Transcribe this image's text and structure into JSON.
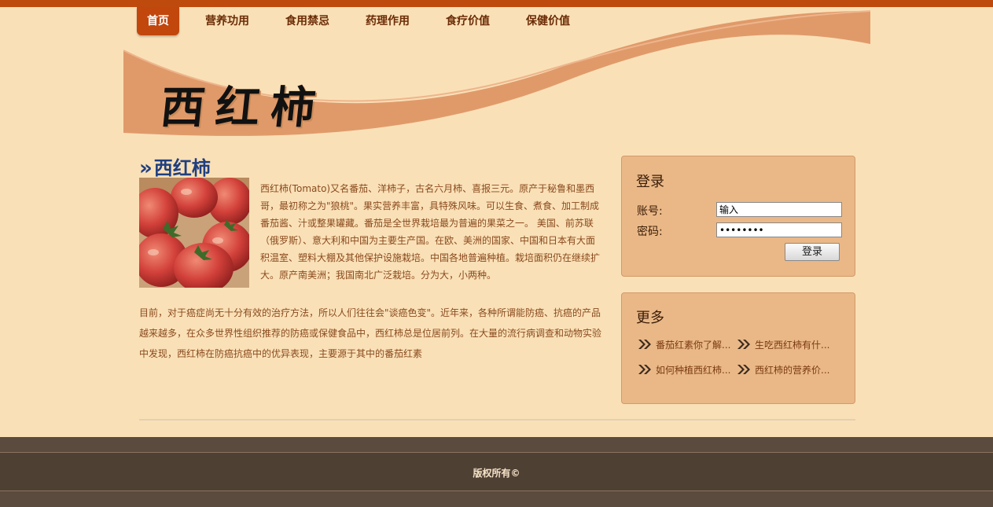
{
  "colors": {
    "top_bar": "#bf4a0e",
    "page_background": "#fae0b7",
    "banner_swoosh": "#e09a6a",
    "nav_active": "#c2470d",
    "title_blue": "#1f3f80",
    "sidebar_box": "#eab887",
    "footer": "#4f4034"
  },
  "nav": {
    "items": [
      {
        "label": "首页",
        "active": true
      },
      {
        "label": "营养功用"
      },
      {
        "label": "食用禁忌"
      },
      {
        "label": "药理作用"
      },
      {
        "label": "食疗价值"
      },
      {
        "label": "保健价值"
      }
    ]
  },
  "banner": {
    "logo_text": "西红柿"
  },
  "article": {
    "title_marker": "»",
    "title": "西红柿",
    "image_icon": "tomato-photo",
    "paragraph1": "西红柿(Tomato)又名番茄、洋柿子，古名六月柿、喜报三元。原产于秘鲁和墨西哥，最初称之为\"狼桃\"。果实营养丰富，具特殊风味。可以生食、煮食、加工制成番茄酱、汁或整果罐藏。番茄是全世界栽培最为普遍的果菜之一。 美国、前苏联（俄罗斯）、意大利和中国为主要生产国。在欧、美洲的国家、中国和日本有大面积温室、塑料大棚及其他保护设施栽培。中国各地普遍种植。栽培面积仍在继续扩大。原产南美洲；我国南北广泛栽培。分为大，小两种。",
    "paragraph2": "目前，对于癌症尚无十分有效的治疗方法，所以人们往往会\"谈癌色变\"。近年来，各种所谓能防癌、抗癌的产品越来越多，在众多世界性组织推荐的防癌或保健食品中，西红柿总是位居前列。在大量的流行病调查和动物实验中发现，西红柿在防癌抗癌中的优异表现，主要源于其中的番茄红素"
  },
  "login": {
    "title": "登录",
    "account_label": "账号:",
    "account_value": "输入",
    "password_label": "密码:",
    "password_value": "••••••••",
    "button_label": "登录"
  },
  "more": {
    "title": "更多",
    "arrow_icon": "double-chevron-right",
    "items": [
      "番茄红素你了解...",
      "生吃西红柿有什...",
      "如何种植西红柿...",
      "西红柿的营养价..."
    ]
  },
  "footer": {
    "copyright": "版权所有©"
  }
}
